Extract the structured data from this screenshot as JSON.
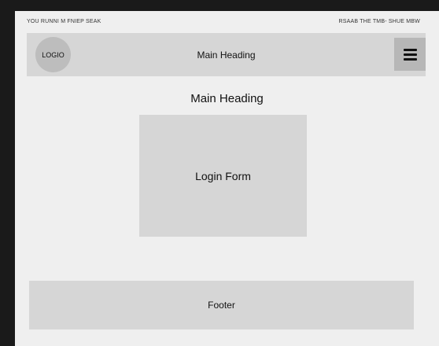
{
  "topline": {
    "left_text": "YOU RUNNI M FNIEP SEAK",
    "right_text": "RSAAB THE TMB- SHUE MBW"
  },
  "header": {
    "logo_text": "LOGIO",
    "title": "Main Heading",
    "menu_icon": "hamburger-menu-icon"
  },
  "main": {
    "heading": "Main Heading",
    "login_form_label": "Login Form"
  },
  "footer": {
    "label": "Footer"
  },
  "colors": {
    "page_bg": "#efefef",
    "block_gray": "#d6d6d6",
    "menu_gray": "#b7b7b7",
    "logo_gray": "#bdbdbd",
    "outer_dark": "#1a1a1a"
  }
}
